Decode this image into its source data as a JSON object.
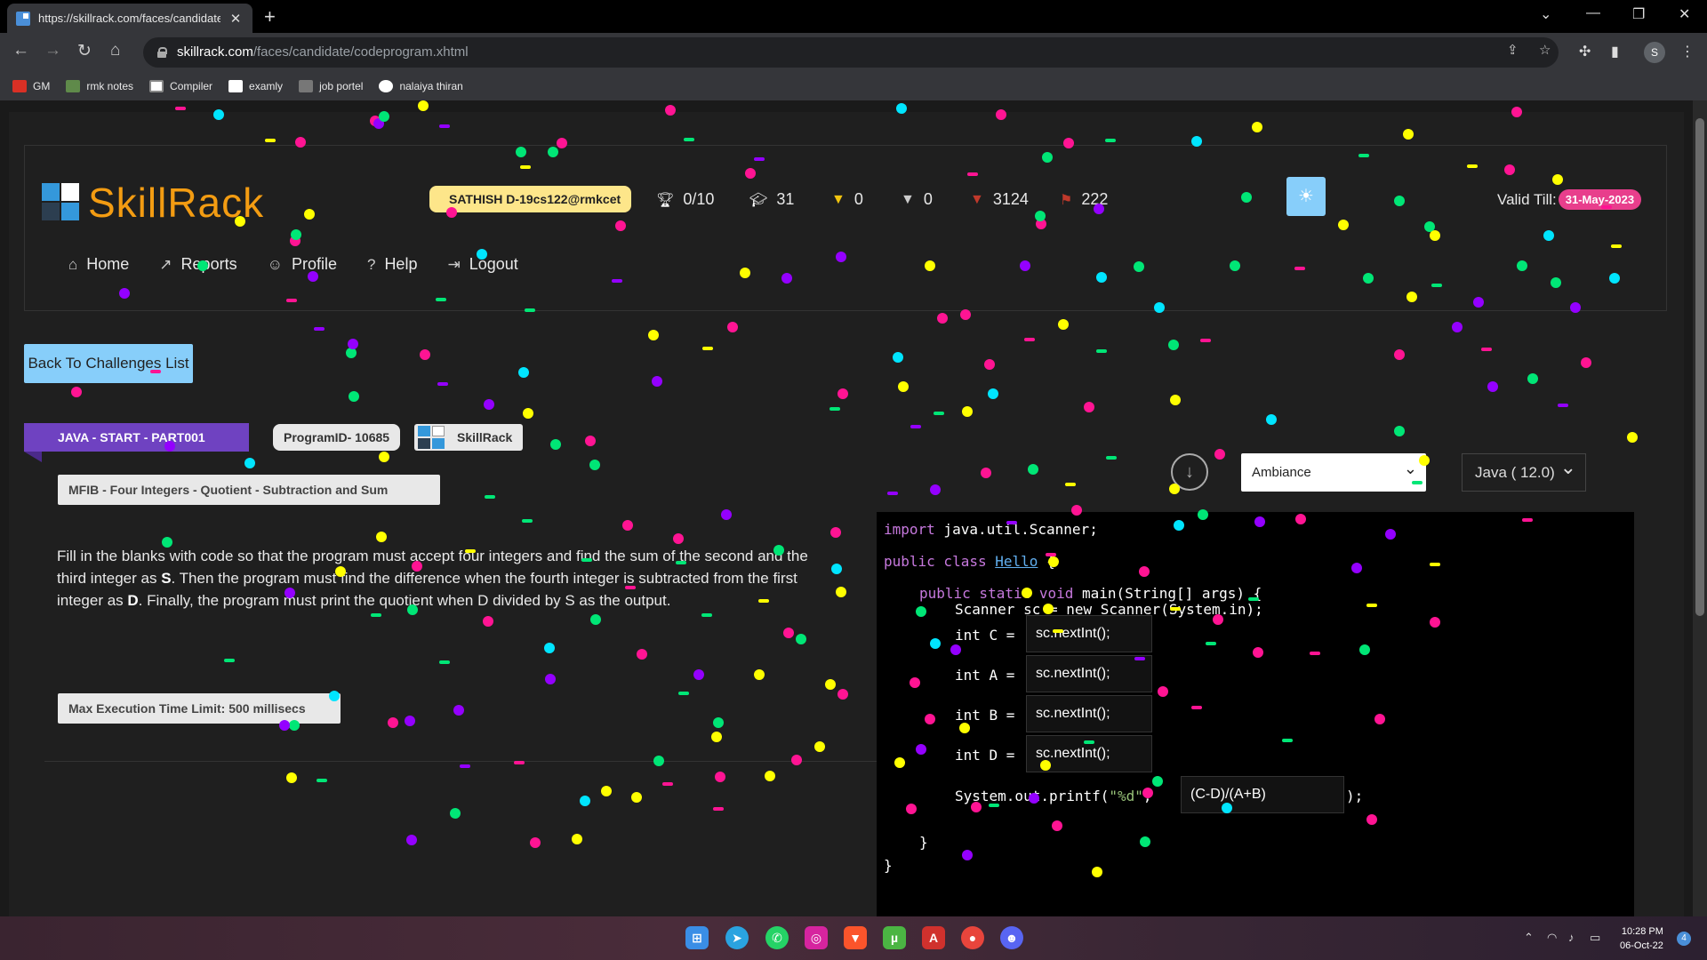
{
  "browser": {
    "tab_title": "https://skillrack.com/faces/candidate",
    "url_host": "skillrack.com",
    "url_path": "/faces/candidate/codeprogram.xhtml",
    "profile_initial": "S",
    "bookmarks": [
      "GM",
      "rmk notes",
      "Compiler",
      "examly",
      "job portel",
      "nalaiya thiran"
    ]
  },
  "header": {
    "logo_text": "SkillRack",
    "user": "SATHISH D-19cs122@rmkcet",
    "stats": {
      "badges": "0/10",
      "courses": "31",
      "gold": "0",
      "silver": "0",
      "bronze": "3124",
      "flags": "222"
    },
    "valid_label": "Valid Till:",
    "valid_date": "31-May-2023"
  },
  "nav": {
    "home": "Home",
    "reports": "Reports",
    "profile": "Profile",
    "help": "Help",
    "logout": "Logout"
  },
  "challenge": {
    "back_button": "Back To Challenges List",
    "track": "JAVA - START - PART001",
    "program_id": "ProgramID- 10685",
    "platform": "SkillRack",
    "title": "MFIB - Four Integers - Quotient - Subtraction and Sum",
    "max_time": "Max Execution Time Limit: 500 millisecs",
    "desc_parts": {
      "p1": "Fill in the blanks with code so that the program must accept four integers and find the sum of the second and the third integer as ",
      "s": "S",
      "p2": ". Then the program must find the difference when the fourth integer is subtracted from the first integer as ",
      "d": "D",
      "p3": ". Finally, the program must print the quotient when D divided by S as the output."
    }
  },
  "editor": {
    "theme": "Ambiance",
    "language": "Java ( 12.0)",
    "line_import_kw": "import",
    "line_import_rest": " java.util.Scanner;",
    "line_class_kw": "public class",
    "line_class_name": "Hello",
    "line_class_brace": " {",
    "line_main_kw": "public static void",
    "line_main_rest": " main(String[] args) {",
    "line_scanner": "Scanner sc = new Scanner(System.in);",
    "var_c": "int C =",
    "var_a": "int A =",
    "var_b": "int B =",
    "var_d": "int D =",
    "blank_c": "sc.nextInt();",
    "blank_a": "sc.nextInt();",
    "blank_b": "sc.nextInt();",
    "blank_d": "sc.nextInt();",
    "printf_prefix": "System.out.printf(",
    "printf_fmt": "\"%d\"",
    "printf_comma": ",",
    "blank_expr": "(C-D)/(A+B)",
    "printf_suffix": ");",
    "close_inner": "}",
    "close_outer": "}"
  },
  "taskbar": {
    "time": "10:28 PM",
    "date": "06-Oct-22",
    "notifications": "4"
  },
  "colors": {
    "accent": "#87cefa",
    "ribbon": "#6f42c1",
    "valid_badge": "#e83e8c",
    "user_pill": "#fde68a"
  }
}
